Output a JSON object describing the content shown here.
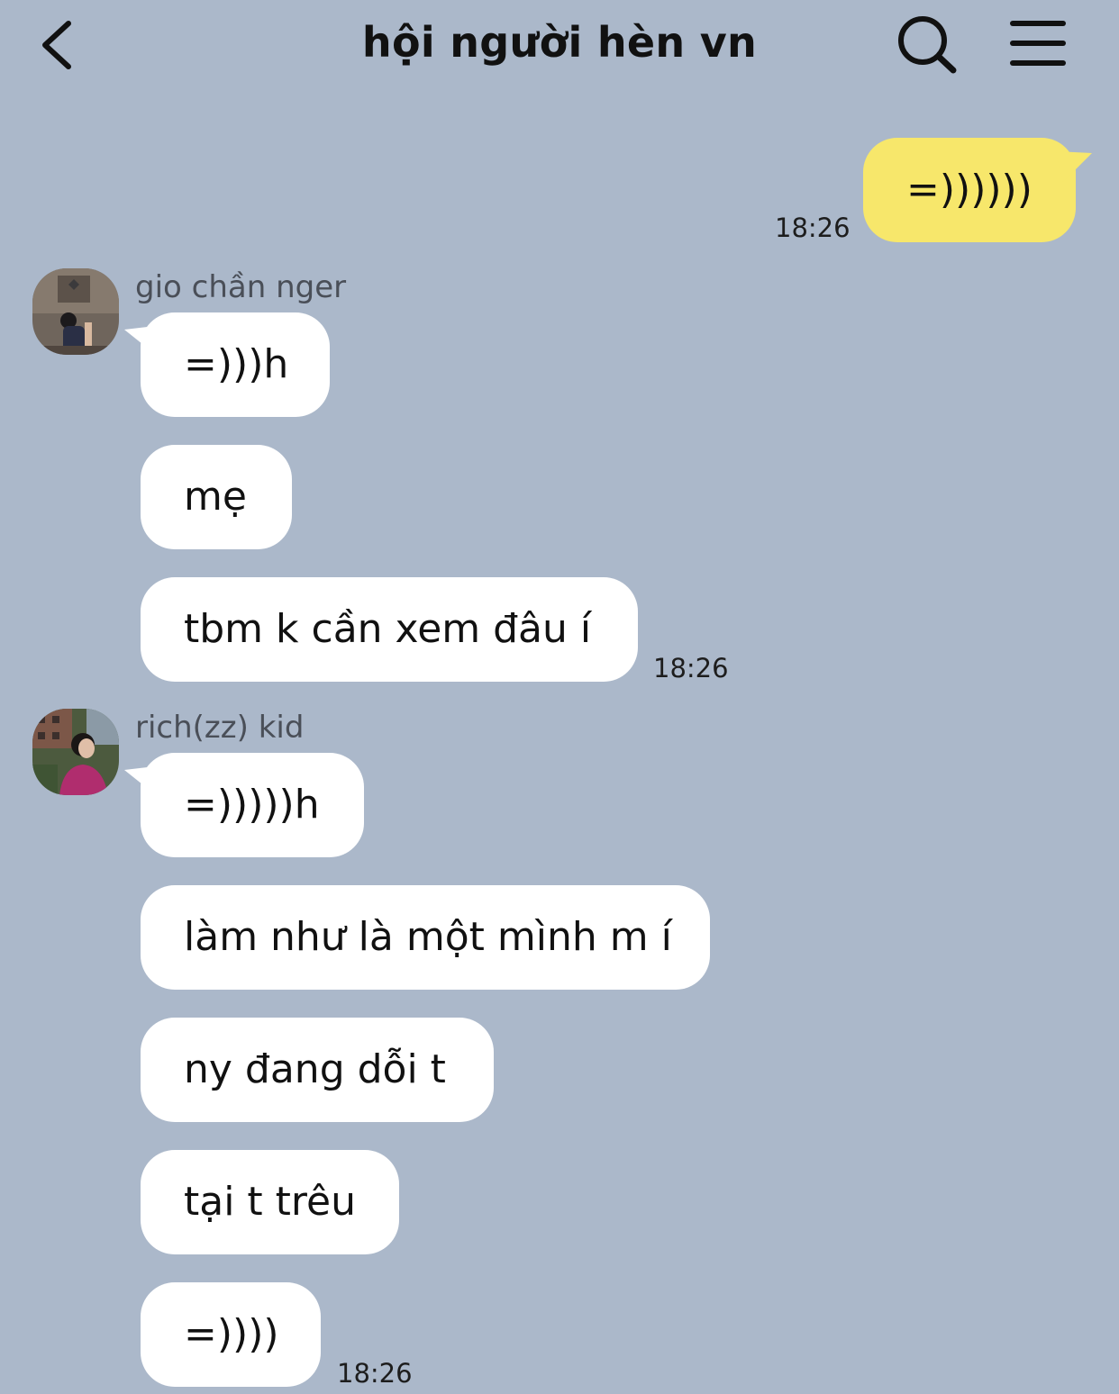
{
  "header": {
    "title": "hội người hèn vn",
    "back_icon": "chevron-left-icon",
    "search_icon": "search-icon",
    "menu_icon": "hamburger-menu-icon"
  },
  "colors": {
    "background": "#abb8ca",
    "incoming_bubble": "#ffffff",
    "outgoing_bubble": "#f7e76b"
  },
  "messages": {
    "outgoing": {
      "text": "=))))))",
      "time": "18:26"
    },
    "group1": {
      "sender": "gio chần nger",
      "bubbles": [
        "=)))h",
        "mẹ",
        "tbm k cần xem đâu í"
      ],
      "time": "18:26"
    },
    "group2": {
      "sender": "rich(zz) kid",
      "bubbles": [
        "=)))))h",
        "làm như là một mình m í",
        "ny đang dỗi t",
        "tại t trêu",
        "=))))"
      ],
      "time": "18:26"
    }
  }
}
